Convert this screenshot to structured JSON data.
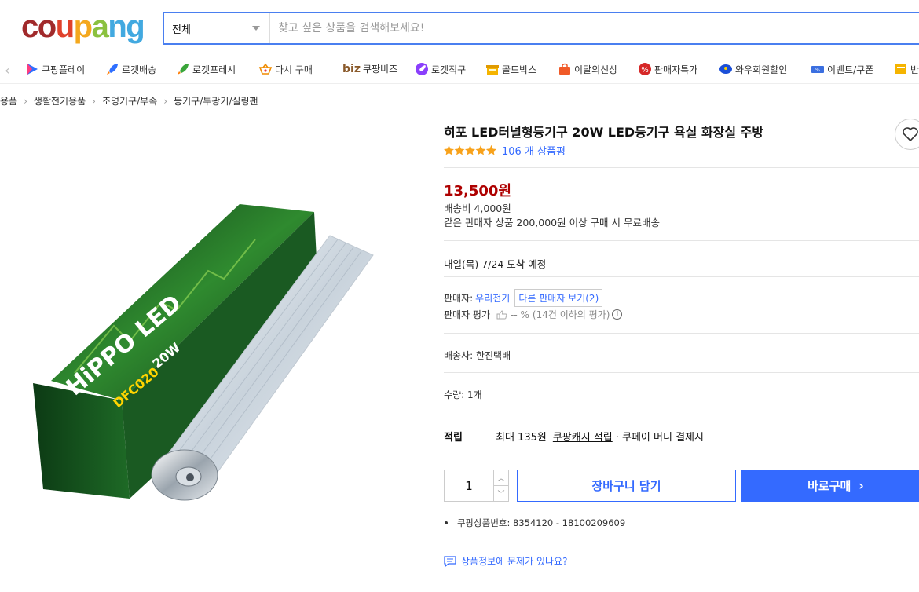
{
  "header": {
    "logo_letters": [
      {
        "char": "c",
        "color": "#a12a2b"
      },
      {
        "char": "o",
        "color": "#a12a2b"
      },
      {
        "char": "u",
        "color": "#e0412b"
      },
      {
        "char": "p",
        "color": "#f4a81d"
      },
      {
        "char": "a",
        "color": "#8bc13f"
      },
      {
        "char": "n",
        "color": "#42a9e0"
      },
      {
        "char": "g",
        "color": "#42a9e0"
      }
    ],
    "search_category": "전체",
    "search_placeholder": "찾고 싶은 상품을 검색해보세요!"
  },
  "catnav": {
    "items": [
      {
        "label": "쿠팡플레이",
        "icon": "play-icon"
      },
      {
        "label": "로켓배송",
        "icon": "rocket-icon"
      },
      {
        "label": "로켓프레시",
        "icon": "rocket-fresh-icon"
      },
      {
        "label": "다시 구매",
        "icon": "basket-icon"
      },
      {
        "label": "쿠팡비즈",
        "icon": "biz-icon",
        "prefix": "biz"
      },
      {
        "label": "로켓직구",
        "icon": "global-rocket-icon"
      },
      {
        "label": "골드박스",
        "icon": "goldbox-icon"
      },
      {
        "label": "이달의신상",
        "icon": "new-bag-icon"
      },
      {
        "label": "판매자특가",
        "icon": "percent-icon"
      },
      {
        "label": "와우회원할인",
        "icon": "wow-icon"
      },
      {
        "label": "이벤트/쿠폰",
        "icon": "coupon-icon"
      },
      {
        "label": "반",
        "icon": "return-icon"
      }
    ]
  },
  "breadcrumb": [
    "용품",
    "생활전기용품",
    "조명기구/부속",
    "등기구/투광기/실링팬"
  ],
  "product": {
    "title": "히포 LED터널형등기구 20W LED등기구 욕실 화장실 주방",
    "rating_stars": 4.5,
    "review_count": "106 개 상품평",
    "price": "13,500원",
    "shipping_fee": "배송비 4,000원",
    "free_shipping": "같은 판매자 상품 200,000원 이상 구매 시 무료배송",
    "arrival": "내일(목) 7/24 도착 예정",
    "seller_label": "판매자:",
    "seller_name": "우리전기",
    "other_sellers": "다른 판매자 보기(2)",
    "seller_rating_label": "판매자 평가",
    "seller_rating_value": "-- %",
    "seller_rating_note": "(14건 이하의 평가)",
    "courier": "배송사:  한진택배",
    "quantity_label": "수량: 1개",
    "reward_title": "적립",
    "reward_text": "최대 135원",
    "reward_link": "쿠팡캐시 적립",
    "reward_suffix": "· 쿠페이 머니 결제시",
    "quantity_value": "1",
    "cart_button": "장바구니 담기",
    "buy_button": "바로구매",
    "product_number": "쿠팡상품번호: 8354120 - 18100209609",
    "report_link": "상품정보에 문제가 있나요?"
  },
  "image_text": {
    "brand": "HiPPO LED",
    "model": "DFC020",
    "wattage": "20W"
  },
  "colors": {
    "accent": "#346aff",
    "price": "#ae0000",
    "star": "#f8a21b",
    "box_green": "#1f6b2b"
  }
}
